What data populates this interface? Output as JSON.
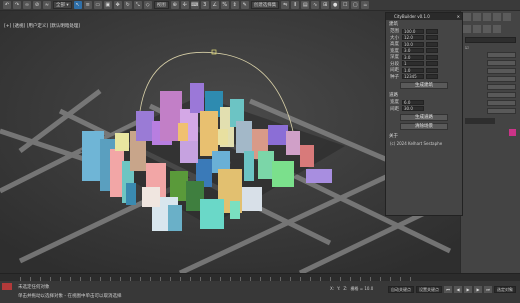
{
  "toolbar": {
    "view_dropdown": "视图",
    "selection_dropdown": "创建选择集"
  },
  "viewport": {
    "label": "[+] [透视] [用户定义] [默认明暗处理]"
  },
  "dialog": {
    "title": "CityBuilder v0.1.0",
    "group_params": "建筑",
    "params": [
      {
        "label": "范围",
        "value": "100.0"
      },
      {
        "label": "大小",
        "value": "12.0"
      },
      {
        "label": "高度",
        "value": "10.0"
      },
      {
        "label": "宽度",
        "value": "3.0"
      },
      {
        "label": "深度",
        "value": "3.0"
      },
      {
        "label": "分段",
        "value": "1"
      },
      {
        "label": "间距",
        "value": "1.0"
      },
      {
        "label": "种子",
        "value": "12345"
      }
    ],
    "generate_btn": "生成建筑",
    "group_roads": "道路",
    "roads": [
      {
        "label": "宽度",
        "value": "6.0"
      },
      {
        "label": "间距",
        "value": "30.0"
      }
    ],
    "road_btn": "生成道路",
    "clear_btn": "清除场景",
    "about_label": "关于",
    "copyright": "(c) 2024 Kelhart Sestaphe"
  },
  "statusbar": {
    "line1": "未选定任何对象",
    "line2": "单击并拖动以选择对象 - 在视图中单击可以取消选择",
    "x_label": "X:",
    "y_label": "Y:",
    "z_label": "Z:",
    "grid": "栅格 = 10.0",
    "auto_key": "自动关键点",
    "set_key": "设置关键点",
    "filter": "选定对象"
  }
}
